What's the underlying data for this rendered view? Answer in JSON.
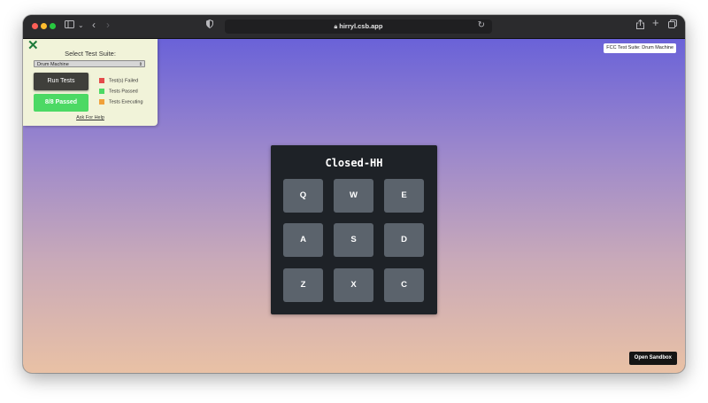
{
  "browser": {
    "url": "hirryl.csb.app"
  },
  "fcc": {
    "close_glyph": "✕",
    "title": "Select Test Suite:",
    "suite_selected": "Drum Machine",
    "run_label": "Run Tests",
    "passed_label": "8/8 Passed",
    "legend": [
      {
        "label": "Test(s) Failed",
        "color": "#e54b4b"
      },
      {
        "label": "Tests Passed",
        "color": "#4cd964"
      },
      {
        "label": "Tests Executing",
        "color": "#f0a13a"
      }
    ],
    "help_label": "Ask For Help",
    "badge": "FCC Test Suite: Drum Machine"
  },
  "drum_machine": {
    "display": "Closed-HH",
    "pads": [
      "Q",
      "W",
      "E",
      "A",
      "S",
      "D",
      "Z",
      "X",
      "C"
    ]
  },
  "sandbox": {
    "open_label": "Open Sandbox"
  },
  "colors": {
    "gradient_top": "#6a62d8",
    "gradient_bottom": "#e9c1a5",
    "pad": "#5b636c",
    "drum_bg": "#1e2227"
  }
}
